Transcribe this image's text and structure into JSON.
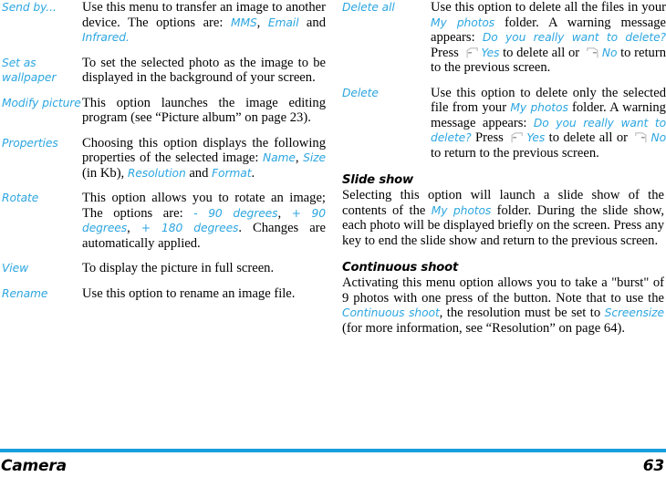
{
  "colors": {
    "accent": "#2CA6E0",
    "rule": "#189FDF",
    "text": "#000000",
    "page_background": "#FFFFFF"
  },
  "left_column": {
    "entries": [
      {
        "term": "Send by...",
        "desc_parts": [
          {
            "type": "text",
            "value": "Use this menu to transfer an image to another device. The options are: "
          },
          {
            "type": "em",
            "value": "MMS"
          },
          {
            "type": "text",
            "value": ", "
          },
          {
            "type": "em",
            "value": "Email"
          },
          {
            "type": "text",
            "value": " and "
          },
          {
            "type": "em",
            "value": "Infrared."
          }
        ]
      },
      {
        "term": "Set as wallpaper",
        "desc_parts": [
          {
            "type": "text",
            "value": "To set the selected photo as the image to be displayed in the background of your screen."
          }
        ]
      },
      {
        "term": "Modify picture",
        "desc_parts": [
          {
            "type": "text",
            "value": "This option launches the image editing program (see “Picture album” on page 23)."
          }
        ]
      },
      {
        "term": "Properties",
        "desc_parts": [
          {
            "type": "text",
            "value": "Choosing this option displays the following properties of the selected image: "
          },
          {
            "type": "em",
            "value": "Name"
          },
          {
            "type": "text",
            "value": ", "
          },
          {
            "type": "em",
            "value": "Size"
          },
          {
            "type": "text",
            "value": " (in Kb), "
          },
          {
            "type": "em",
            "value": "Resolution"
          },
          {
            "type": "text",
            "value": " and "
          },
          {
            "type": "em",
            "value": "Format"
          },
          {
            "type": "text",
            "value": "."
          }
        ]
      },
      {
        "term": "Rotate",
        "desc_parts": [
          {
            "type": "text",
            "value": "This option allows you to rotate an image; The options are: "
          },
          {
            "type": "em",
            "value": "- 90 degrees"
          },
          {
            "type": "text",
            "value": ", "
          },
          {
            "type": "em",
            "value": "+ 90 degrees"
          },
          {
            "type": "text",
            "value": ", "
          },
          {
            "type": "em",
            "value": "+ 180 degrees"
          },
          {
            "type": "text",
            "value": ". Changes are automatically applied."
          }
        ]
      },
      {
        "term": "View",
        "desc_parts": [
          {
            "type": "text",
            "value": "To display the picture in full screen."
          }
        ]
      },
      {
        "term": "Rename",
        "desc_parts": [
          {
            "type": "text",
            "value": "Use this option to rename an image file."
          }
        ]
      }
    ]
  },
  "right_column": {
    "entries": [
      {
        "term": "Delete all",
        "desc_parts": [
          {
            "type": "text",
            "value": "Use this option to delete all the files in your "
          },
          {
            "type": "em",
            "value": "My photos"
          },
          {
            "type": "text",
            "value": " folder. A warning message appears: "
          },
          {
            "type": "em",
            "value": "Do you really want to delete?"
          },
          {
            "type": "text",
            "value": " Press "
          },
          {
            "type": "icon",
            "value": "left-softkey-icon"
          },
          {
            "type": "em",
            "value": "Yes"
          },
          {
            "type": "text",
            "value": " to delete all or "
          },
          {
            "type": "icon",
            "value": "right-softkey-icon"
          },
          {
            "type": "em",
            "value": "No"
          },
          {
            "type": "text",
            "value": " to return to the previous screen."
          }
        ]
      },
      {
        "term": "Delete",
        "desc_parts": [
          {
            "type": "text",
            "value": "Use this option to delete only the selected file from your "
          },
          {
            "type": "em",
            "value": "My photos"
          },
          {
            "type": "text",
            "value": " folder. A warning message appears: "
          },
          {
            "type": "em",
            "value": "Do you really want to delete?"
          },
          {
            "type": "text",
            "value": " Press "
          },
          {
            "type": "icon",
            "value": "left-softkey-icon"
          },
          {
            "type": "em",
            "value": "Yes"
          },
          {
            "type": "text",
            "value": " to delete all or "
          },
          {
            "type": "icon",
            "value": "right-softkey-icon"
          },
          {
            "type": "em",
            "value": "No"
          },
          {
            "type": "text",
            "value": " to return to the previous screen."
          }
        ]
      }
    ],
    "sections": [
      {
        "title": "Slide show",
        "body_parts": [
          {
            "type": "text",
            "value": "Selecting this option will launch a slide show of the contents of the "
          },
          {
            "type": "em",
            "value": "My photos"
          },
          {
            "type": "text",
            "value": " folder. During the slide show, each photo will be displayed briefly on the screen. Press any key to end the slide show and return to the previous screen."
          }
        ]
      },
      {
        "title": "Continuous shoot",
        "body_parts": [
          {
            "type": "text",
            "value": "Activating this menu option allows you to take a \"burst\" of 9 photos with one press of the button. Note that to use the "
          },
          {
            "type": "em",
            "value": "Continuous shoot"
          },
          {
            "type": "text",
            "value": ", the resolution must be set to "
          },
          {
            "type": "em",
            "value": "Screensize"
          },
          {
            "type": "text",
            "value": " (for more information, see “Resolution” on page 64)."
          }
        ]
      }
    ]
  },
  "footer": {
    "chapter": "Camera",
    "page_number": "63"
  }
}
